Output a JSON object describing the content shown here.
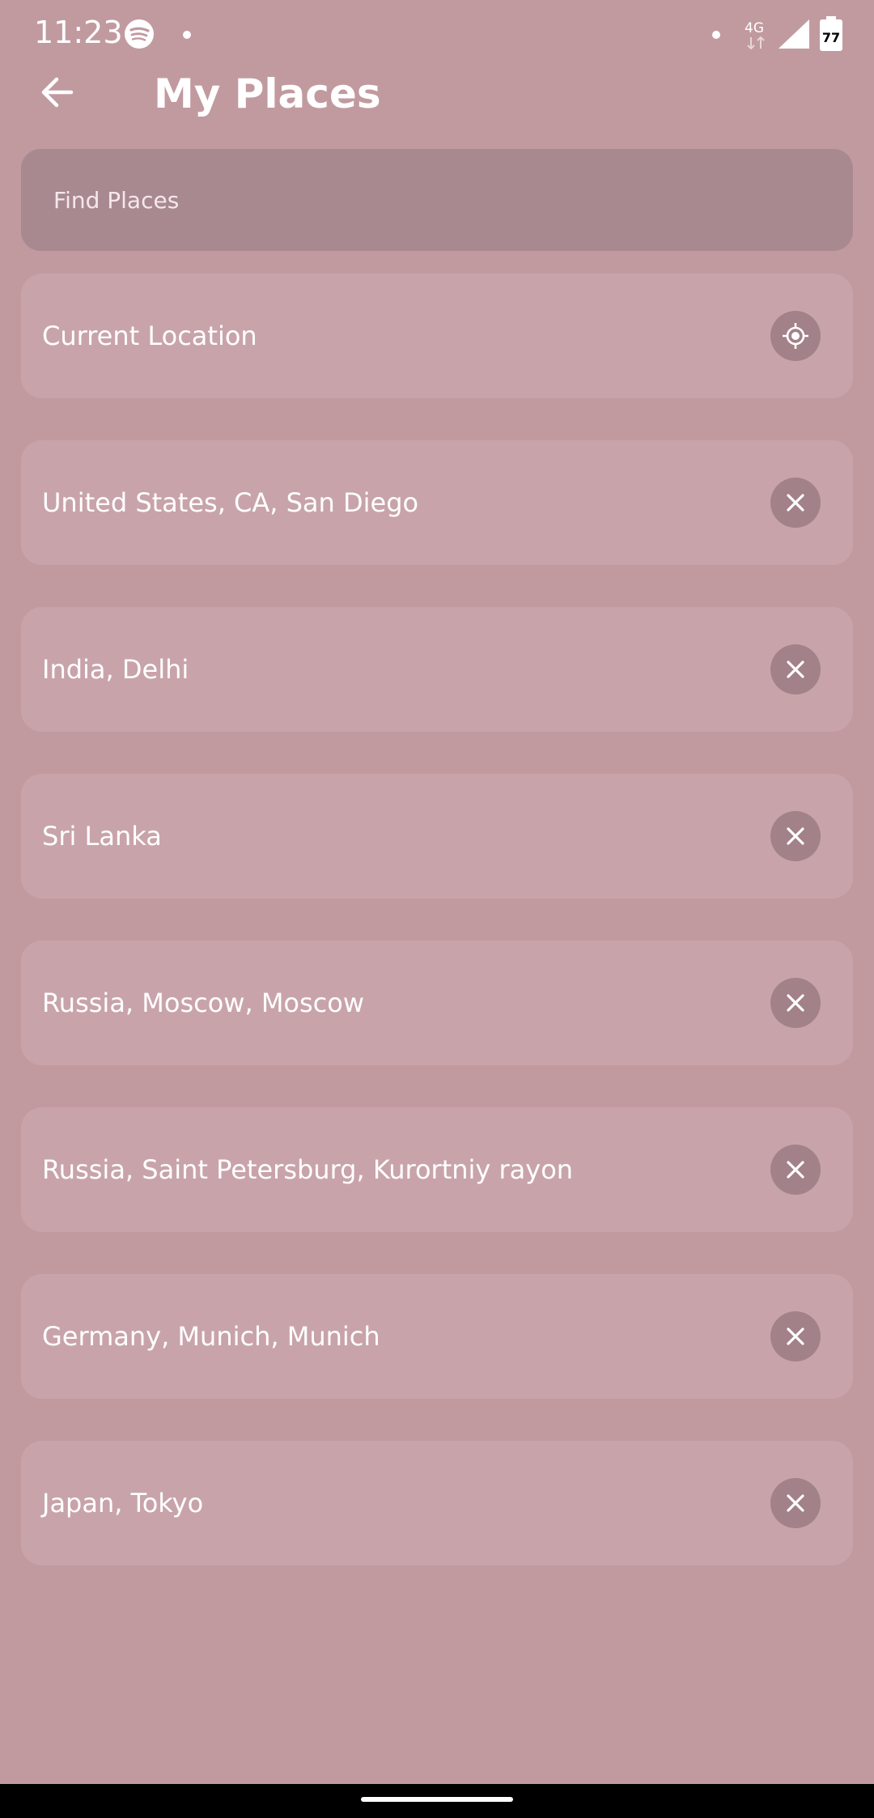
{
  "status_bar": {
    "time": "11:23",
    "network": "4G",
    "battery": "77"
  },
  "header": {
    "title": "My Places"
  },
  "search": {
    "placeholder": "Find Places"
  },
  "places": [
    {
      "label": "Current Location",
      "action_icon": "my-location-icon"
    },
    {
      "label": "United States, CA, San Diego",
      "action_icon": "close-icon"
    },
    {
      "label": "India, Delhi",
      "action_icon": "close-icon"
    },
    {
      "label": "Sri Lanka",
      "action_icon": "close-icon"
    },
    {
      "label": "Russia, Moscow, Moscow",
      "action_icon": "close-icon"
    },
    {
      "label": "Russia, Saint Petersburg, Kurortniy rayon",
      "action_icon": "close-icon"
    },
    {
      "label": "Germany, Munich, Munich",
      "action_icon": "close-icon"
    },
    {
      "label": "Japan, Tokyo",
      "action_icon": "close-icon"
    }
  ],
  "colors": {
    "background": "#c19aa0",
    "card": "#c8a4aa",
    "search_field": "#a98990",
    "button": "#a28188"
  }
}
